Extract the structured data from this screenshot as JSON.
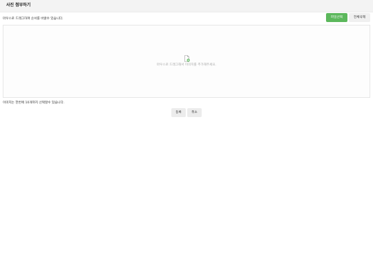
{
  "header": {
    "title": "사진 첨부하기"
  },
  "toolbar": {
    "instruction": "마우스로 드래그하여 순서를 바꿀수 있습니다.",
    "file_select_label": "파일선택",
    "delete_all_label": "전체삭제"
  },
  "dropzone": {
    "hint": "마우스로 드래그해서 이미지를 추가해주세요.",
    "icon": "file-add-icon"
  },
  "footer": {
    "limit_note": "이미지는 한번에 10개까지 선택할수 있습니다.",
    "register_label": "등록",
    "cancel_label": "취소"
  },
  "colors": {
    "accent": "#5cb85c",
    "header_bg": "#f3f3f3",
    "button_bg": "#ececec"
  }
}
